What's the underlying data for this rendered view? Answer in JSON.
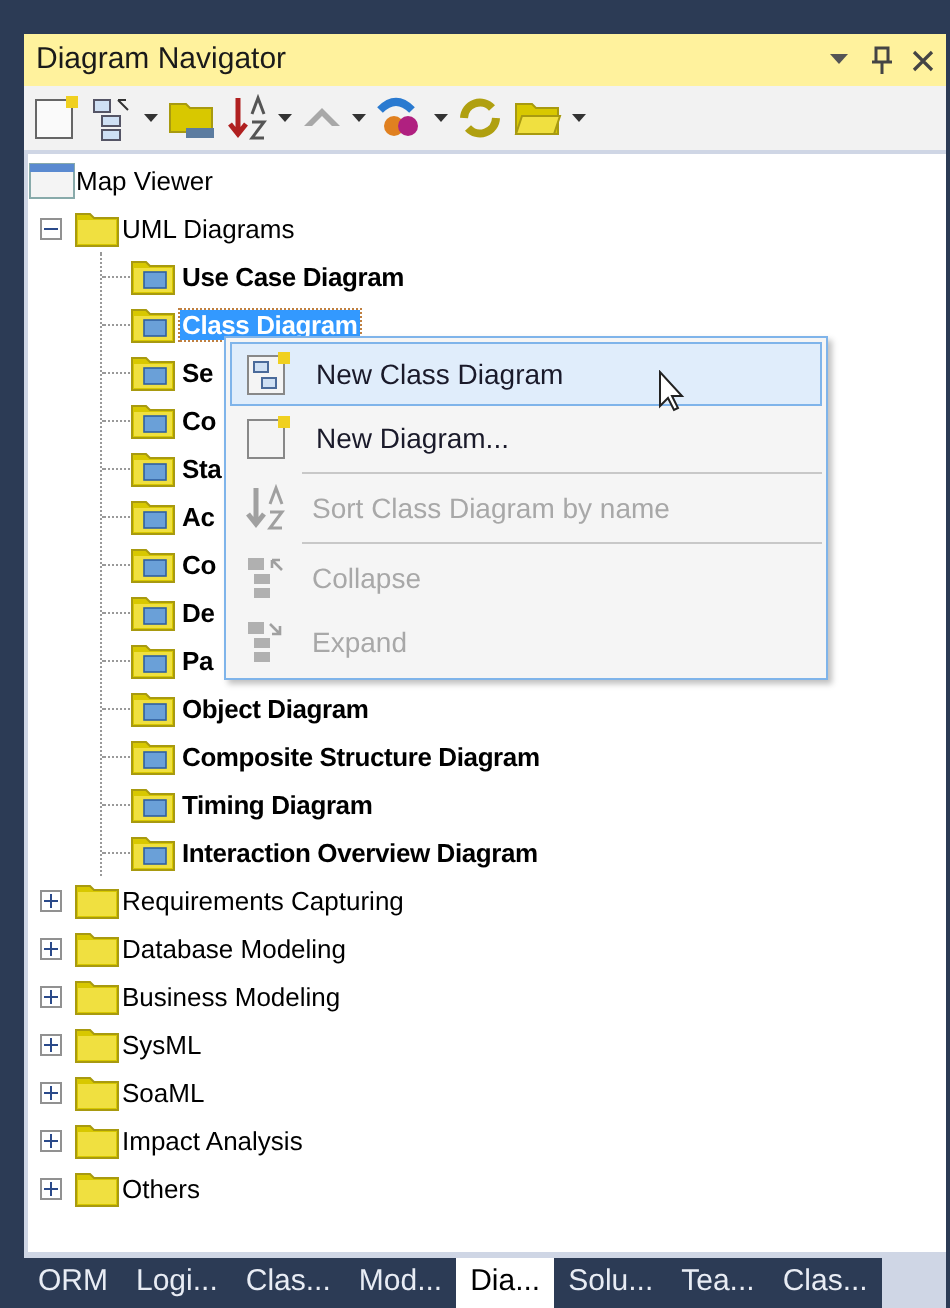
{
  "panel": {
    "title": "Diagram Navigator"
  },
  "tree": [
    {
      "label": "Map Viewer",
      "kind": "map"
    },
    {
      "label": "UML Diagrams",
      "kind": "folder",
      "expanded": true,
      "children": [
        {
          "label": "Use Case Diagram",
          "selected": false
        },
        {
          "label": "Class Diagram",
          "selected": true
        },
        {
          "label": "Se",
          "selected": false
        },
        {
          "label": "Co",
          "selected": false
        },
        {
          "label": "Sta",
          "selected": false
        },
        {
          "label": "Ac",
          "selected": false
        },
        {
          "label": "Co",
          "selected": false
        },
        {
          "label": "De",
          "selected": false
        },
        {
          "label": "Pa",
          "selected": false
        },
        {
          "label": "Object Diagram",
          "selected": false
        },
        {
          "label": "Composite Structure Diagram",
          "selected": false
        },
        {
          "label": "Timing Diagram",
          "selected": false
        },
        {
          "label": "Interaction Overview Diagram",
          "selected": false
        }
      ]
    },
    {
      "label": "Requirements Capturing",
      "kind": "folder",
      "expanded": false
    },
    {
      "label": "Database Modeling",
      "kind": "folder",
      "expanded": false
    },
    {
      "label": "Business Modeling",
      "kind": "folder",
      "expanded": false
    },
    {
      "label": "SysML",
      "kind": "folder",
      "expanded": false
    },
    {
      "label": "SoaML",
      "kind": "folder",
      "expanded": false
    },
    {
      "label": "Impact Analysis",
      "kind": "folder",
      "expanded": false
    },
    {
      "label": "Others",
      "kind": "folder",
      "expanded": false
    }
  ],
  "context_menu": [
    {
      "label": "New Class Diagram",
      "kind": "new-class",
      "disabled": false,
      "selected": true
    },
    {
      "label": "New Diagram...",
      "kind": "new",
      "disabled": false,
      "selected": false
    },
    {
      "label": "Sort Class Diagram by name",
      "kind": "sort",
      "disabled": true,
      "selected": false
    },
    {
      "label": "Collapse",
      "kind": "collapse",
      "disabled": true,
      "selected": false
    },
    {
      "label": "Expand",
      "kind": "expand",
      "disabled": true,
      "selected": false
    }
  ],
  "bottom_tabs": [
    {
      "label": "ORM",
      "selected": false
    },
    {
      "label": "Logi...",
      "selected": false
    },
    {
      "label": "Clas...",
      "selected": false
    },
    {
      "label": "Mod...",
      "selected": false
    },
    {
      "label": "Dia...",
      "selected": true
    },
    {
      "label": "Solu...",
      "selected": false
    },
    {
      "label": "Tea...",
      "selected": false
    },
    {
      "label": "Clas...",
      "selected": false
    }
  ]
}
